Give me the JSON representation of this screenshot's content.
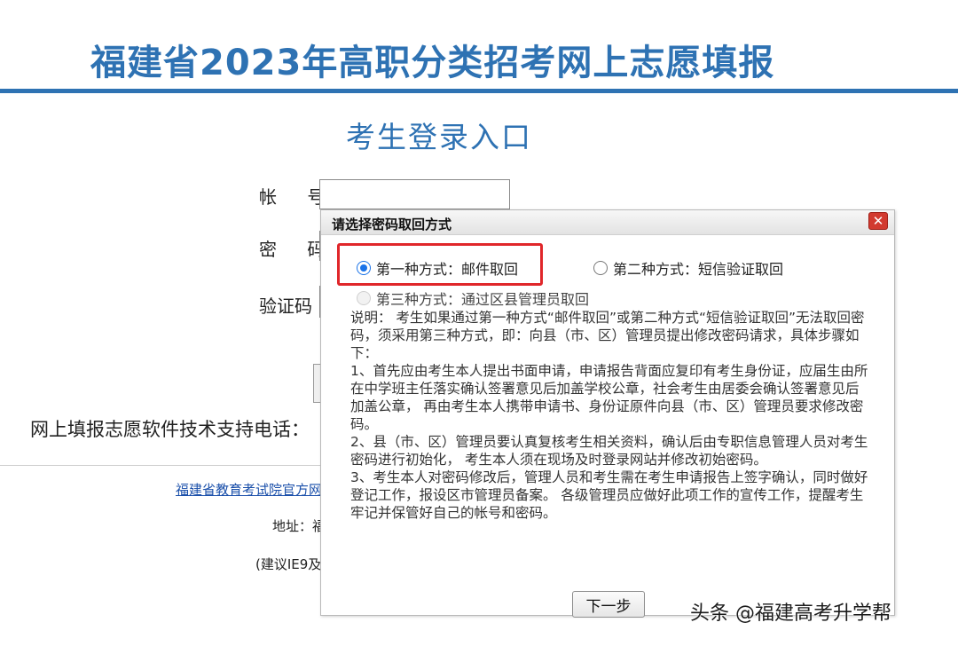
{
  "header": {
    "title": "福建省2023年高职分类招考网上志愿填报"
  },
  "login": {
    "title": "考生登录入口",
    "account_label": "帐 号",
    "password_label": "密 码",
    "captcha_label": "验证码",
    "support_line": "网上填报志愿软件技术支持电话："
  },
  "footer": {
    "link_text": "福建省教育考试院官方网站",
    "address_label": "地址：福",
    "browser_note": "(建议IE9及"
  },
  "dialog": {
    "title": "请选择密码取回方式",
    "close_label": "✕",
    "options": [
      {
        "label": "第一种方式：邮件取回",
        "checked": true,
        "disabled": false
      },
      {
        "label": "第二种方式：短信验证取回",
        "checked": false,
        "disabled": false
      },
      {
        "label": "第三种方式：通过区县管理员取回",
        "checked": false,
        "disabled": true
      }
    ],
    "instructions": [
      "说明： 考生如果通过第一种方式“邮件取回”或第二种方式“短信验证取回”无法取回密码，须采用第三种方式，即：向县（市、区）管理员提出修改密码请求，具体步骤如下：",
      "1、首先应由考生本人提出书面申请，申请报告背面应复印有考生身份证，应届生由所在中学班主任落实确认签署意见后加盖学校公章，社会考生由居委会确认签署意见后加盖公章， 再由考生本人携带申请书、身份证原件向县（市、区）管理员要求修改密码。",
      "2、县（市、区）管理员要认真复核考生相关资料，确认后由专职信息管理人员对考生密码进行初始化， 考生本人须在现场及时登录网站并修改初始密码。",
      "3、考生本人对密码修改后，管理人员和考生需在考生申请报告上签字确认，同时做好登记工作，报设区市管理员备案。 各级管理员应做好此项工作的宣传工作，提醒考生牢记并保管好自己的帐号和密码。"
    ],
    "next_button": "下一步"
  },
  "watermark": "头条 @福建高考升学帮",
  "colors": {
    "brand_blue": "#2e72b3",
    "highlight_red": "#e0262a",
    "close_red": "#d23a2f"
  }
}
